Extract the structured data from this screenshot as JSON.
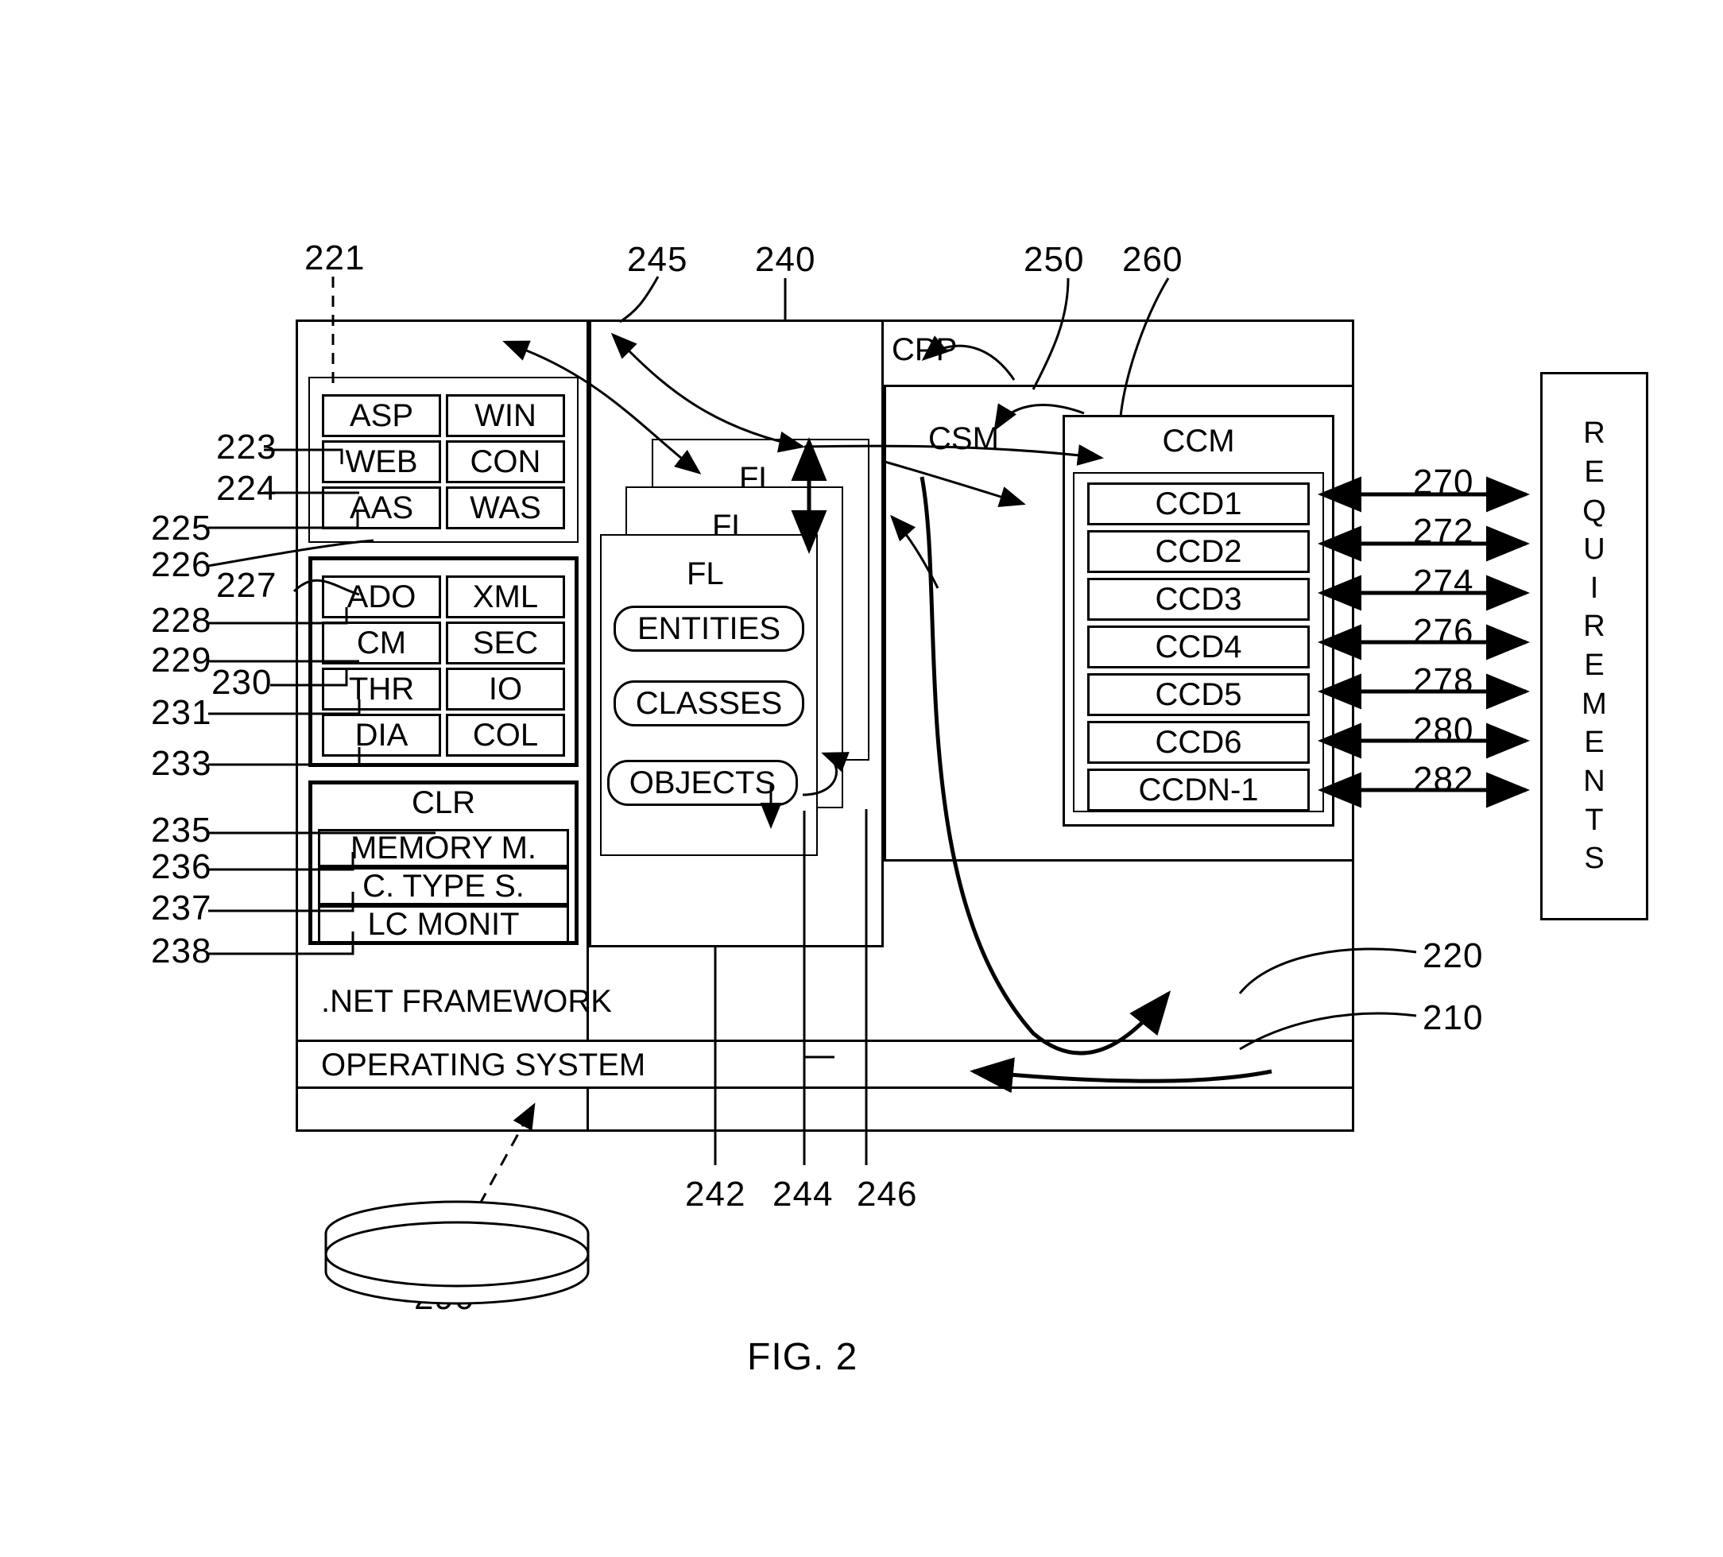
{
  "figure": {
    "caption": "FIG. 2"
  },
  "outer": {
    "system_box_label": "",
    "net_framework_label": ".NET FRAMEWORK",
    "operating_system_label": "OPERATING SYSTEM"
  },
  "left_panel": {
    "ref_221": "221",
    "group_a": {
      "cells": [
        "ASP",
        "WIN",
        "WEB",
        "CON",
        "AAS",
        "WAS"
      ],
      "refs": [
        "223",
        "224",
        "225",
        "226"
      ]
    },
    "group_b": {
      "cells": [
        "ADO",
        "XML",
        "CM",
        "SEC",
        "THR",
        "IO",
        "DIA",
        "COL"
      ],
      "refs": [
        "227",
        "228",
        "229",
        "230",
        "231",
        "233"
      ]
    },
    "group_c": {
      "title": "CLR",
      "cells": [
        "MEMORY M.",
        "C. TYPE S.",
        "LC MONIT"
      ],
      "refs": [
        "235",
        "236",
        "237",
        "238"
      ]
    }
  },
  "middle_panel": {
    "ref_245": "245",
    "ref_240": "240",
    "fl_stack": [
      "FL",
      "FL",
      "FL"
    ],
    "pills": [
      "ENTITIES",
      "CLASSES",
      "OBJECTS"
    ],
    "bottom_refs": [
      "242",
      "244",
      "246"
    ]
  },
  "right_panel": {
    "ref_250": "250",
    "ref_260": "260",
    "cpp_label": "CPP",
    "csm_label": "CSM",
    "ccm_label": "CCM",
    "ccd_items": [
      "CCD1",
      "CCD2",
      "CCD3",
      "CCD4",
      "CCD5",
      "CCD6",
      "CCDN-1"
    ],
    "arrow_refs": [
      "270",
      "272",
      "274",
      "276",
      "278",
      "280",
      "282"
    ]
  },
  "requirements": {
    "letters": [
      "R",
      "E",
      "Q",
      "U",
      "I",
      "R",
      "E",
      "M",
      "E",
      "N",
      "T",
      "S"
    ]
  },
  "side_refs": {
    "ref_220": "220",
    "ref_210": "210"
  },
  "storage": {
    "ref_290": "290"
  }
}
